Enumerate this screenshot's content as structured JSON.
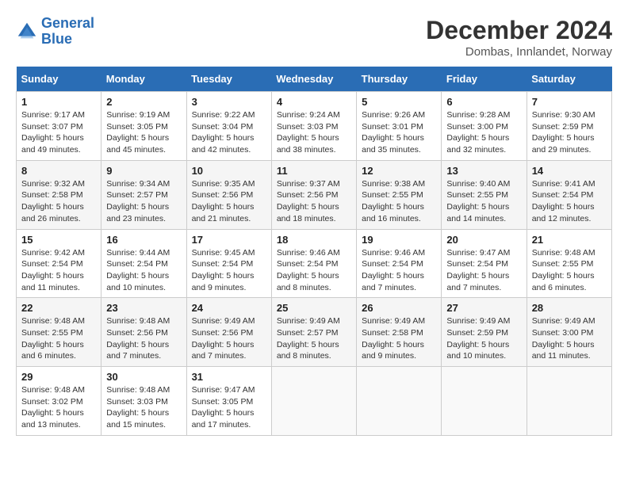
{
  "logo": {
    "line1": "General",
    "line2": "Blue"
  },
  "title": "December 2024",
  "subtitle": "Dombas, Innlandet, Norway",
  "days_header": [
    "Sunday",
    "Monday",
    "Tuesday",
    "Wednesday",
    "Thursday",
    "Friday",
    "Saturday"
  ],
  "weeks": [
    [
      {
        "num": "1",
        "sunrise": "9:17 AM",
        "sunset": "3:07 PM",
        "daylight": "5 hours and 49 minutes."
      },
      {
        "num": "2",
        "sunrise": "9:19 AM",
        "sunset": "3:05 PM",
        "daylight": "5 hours and 45 minutes."
      },
      {
        "num": "3",
        "sunrise": "9:22 AM",
        "sunset": "3:04 PM",
        "daylight": "5 hours and 42 minutes."
      },
      {
        "num": "4",
        "sunrise": "9:24 AM",
        "sunset": "3:03 PM",
        "daylight": "5 hours and 38 minutes."
      },
      {
        "num": "5",
        "sunrise": "9:26 AM",
        "sunset": "3:01 PM",
        "daylight": "5 hours and 35 minutes."
      },
      {
        "num": "6",
        "sunrise": "9:28 AM",
        "sunset": "3:00 PM",
        "daylight": "5 hours and 32 minutes."
      },
      {
        "num": "7",
        "sunrise": "9:30 AM",
        "sunset": "2:59 PM",
        "daylight": "5 hours and 29 minutes."
      }
    ],
    [
      {
        "num": "8",
        "sunrise": "9:32 AM",
        "sunset": "2:58 PM",
        "daylight": "5 hours and 26 minutes."
      },
      {
        "num": "9",
        "sunrise": "9:34 AM",
        "sunset": "2:57 PM",
        "daylight": "5 hours and 23 minutes."
      },
      {
        "num": "10",
        "sunrise": "9:35 AM",
        "sunset": "2:56 PM",
        "daylight": "5 hours and 21 minutes."
      },
      {
        "num": "11",
        "sunrise": "9:37 AM",
        "sunset": "2:56 PM",
        "daylight": "5 hours and 18 minutes."
      },
      {
        "num": "12",
        "sunrise": "9:38 AM",
        "sunset": "2:55 PM",
        "daylight": "5 hours and 16 minutes."
      },
      {
        "num": "13",
        "sunrise": "9:40 AM",
        "sunset": "2:55 PM",
        "daylight": "5 hours and 14 minutes."
      },
      {
        "num": "14",
        "sunrise": "9:41 AM",
        "sunset": "2:54 PM",
        "daylight": "5 hours and 12 minutes."
      }
    ],
    [
      {
        "num": "15",
        "sunrise": "9:42 AM",
        "sunset": "2:54 PM",
        "daylight": "5 hours and 11 minutes."
      },
      {
        "num": "16",
        "sunrise": "9:44 AM",
        "sunset": "2:54 PM",
        "daylight": "5 hours and 10 minutes."
      },
      {
        "num": "17",
        "sunrise": "9:45 AM",
        "sunset": "2:54 PM",
        "daylight": "5 hours and 9 minutes."
      },
      {
        "num": "18",
        "sunrise": "9:46 AM",
        "sunset": "2:54 PM",
        "daylight": "5 hours and 8 minutes."
      },
      {
        "num": "19",
        "sunrise": "9:46 AM",
        "sunset": "2:54 PM",
        "daylight": "5 hours and 7 minutes."
      },
      {
        "num": "20",
        "sunrise": "9:47 AM",
        "sunset": "2:54 PM",
        "daylight": "5 hours and 7 minutes."
      },
      {
        "num": "21",
        "sunrise": "9:48 AM",
        "sunset": "2:55 PM",
        "daylight": "5 hours and 6 minutes."
      }
    ],
    [
      {
        "num": "22",
        "sunrise": "9:48 AM",
        "sunset": "2:55 PM",
        "daylight": "5 hours and 6 minutes."
      },
      {
        "num": "23",
        "sunrise": "9:48 AM",
        "sunset": "2:56 PM",
        "daylight": "5 hours and 7 minutes."
      },
      {
        "num": "24",
        "sunrise": "9:49 AM",
        "sunset": "2:56 PM",
        "daylight": "5 hours and 7 minutes."
      },
      {
        "num": "25",
        "sunrise": "9:49 AM",
        "sunset": "2:57 PM",
        "daylight": "5 hours and 8 minutes."
      },
      {
        "num": "26",
        "sunrise": "9:49 AM",
        "sunset": "2:58 PM",
        "daylight": "5 hours and 9 minutes."
      },
      {
        "num": "27",
        "sunrise": "9:49 AM",
        "sunset": "2:59 PM",
        "daylight": "5 hours and 10 minutes."
      },
      {
        "num": "28",
        "sunrise": "9:49 AM",
        "sunset": "3:00 PM",
        "daylight": "5 hours and 11 minutes."
      }
    ],
    [
      {
        "num": "29",
        "sunrise": "9:48 AM",
        "sunset": "3:02 PM",
        "daylight": "5 hours and 13 minutes."
      },
      {
        "num": "30",
        "sunrise": "9:48 AM",
        "sunset": "3:03 PM",
        "daylight": "5 hours and 15 minutes."
      },
      {
        "num": "31",
        "sunrise": "9:47 AM",
        "sunset": "3:05 PM",
        "daylight": "5 hours and 17 minutes."
      },
      null,
      null,
      null,
      null
    ]
  ]
}
